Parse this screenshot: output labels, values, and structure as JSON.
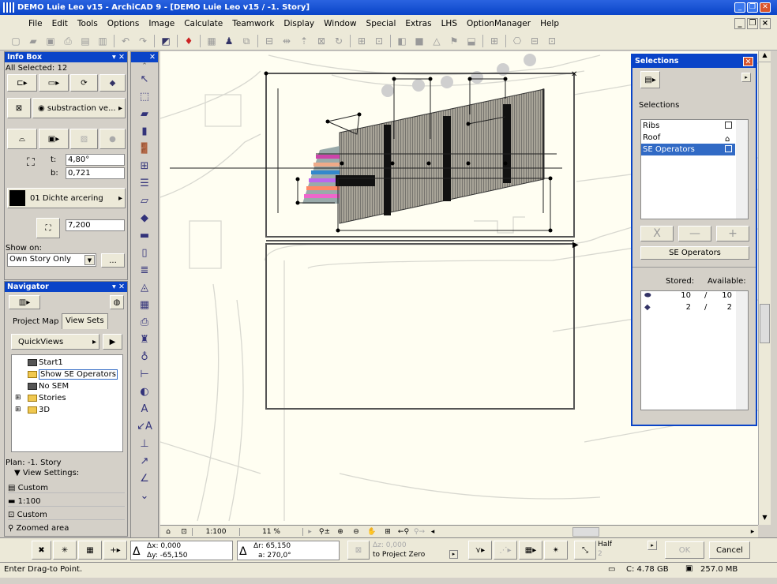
{
  "window": {
    "title": "DEMO Luie Leo v15 - ArchiCAD 9 - [DEMO Luie Leo v15 / -1. Story]"
  },
  "menu": [
    "File",
    "Edit",
    "Tools",
    "Options",
    "Image",
    "Calculate",
    "Teamwork",
    "Display",
    "Window",
    "Special",
    "Extras",
    "LHS",
    "OptionManager",
    "Help"
  ],
  "infobox": {
    "title": "Info Box",
    "selected": "All Selected: 12",
    "layer": "substraction ve...",
    "angle_label": "t:",
    "angle_value": "4,80°",
    "b_label": "b:",
    "b_value": "0,721",
    "fill": "01 Dichte arcering",
    "height_value": "7,200",
    "show_on_label": "Show on:",
    "show_on_value": "Own Story Only",
    "more_button": "..."
  },
  "navigator": {
    "title": "Navigator",
    "tabs": [
      "Project Map",
      "View Sets"
    ],
    "active_tab": "View Sets",
    "quickviews": "QuickViews",
    "tree": [
      "Start1",
      "Show SE Operators",
      "No SEM",
      "Stories",
      "3D"
    ],
    "selected_item": "Show SE Operators",
    "plan": "Plan: -1. Story",
    "view_settings": "View Settings:",
    "settings": [
      "Custom",
      "1:100",
      "Custom",
      "Zoomed area"
    ]
  },
  "selections": {
    "title": "Selections",
    "label": "Selections",
    "items": [
      "Ribs",
      "Roof",
      "SE Operators"
    ],
    "selected": "SE Operators",
    "delete_btn": "X",
    "minus_btn": "—",
    "plus_btn": "+",
    "name_btn": "SE Operators",
    "stored_label": "Stored:",
    "available_label": "Available:",
    "counts": [
      {
        "stored": "10",
        "sep": "/",
        "available": "10"
      },
      {
        "stored": "2",
        "sep": "/",
        "available": "2"
      }
    ]
  },
  "navbar": {
    "scale": "1:100",
    "zoom": "11 %"
  },
  "coords": {
    "dx": "Δx: 0,000",
    "dy": "Δy: -65,150",
    "dr": "Δr: 65,150",
    "a": "a: 270,0°",
    "dz": "Δz: 0,000",
    "ref": "to Project Zero",
    "snap": "Half",
    "snap_num": "2",
    "ok": "OK",
    "cancel": "Cancel"
  },
  "status": {
    "prompt": "Enter Drag-to Point.",
    "disk": "C: 4.78 GB",
    "memory": "257.0 MB"
  },
  "colors": {
    "titlebar": "#0a44c8",
    "canvas": "#fffef2",
    "selection": "#316ac5"
  },
  "toolbox_icons": [
    "arrow-icon",
    "marquee-icon",
    "wall-icon",
    "column-icon",
    "door-icon",
    "window-icon",
    "stair-icon",
    "slab-icon",
    "roof-icon",
    "beam-icon",
    "cylinder-icon",
    "object-stack-icon",
    "mesh-icon",
    "zone-icon",
    "camera-icon",
    "chair-icon",
    "lamp-icon",
    "dimension-icon",
    "section-icon",
    "text-icon",
    "label-icon",
    "level-icon",
    "radial-dim-icon",
    "angle-dim-icon",
    "elevation-icon"
  ]
}
